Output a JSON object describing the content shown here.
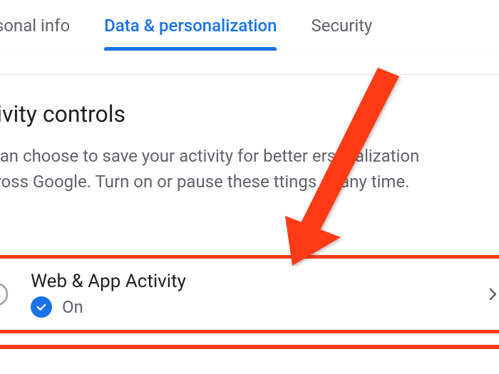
{
  "tabs": {
    "personal_info": "ersonal info",
    "data_personalization": "Data & personalization",
    "security": "Security"
  },
  "section": {
    "title": "ctivity controls",
    "description": "u can choose to save your activity for better ersonalization across Google. Turn on or pause these ttings at any time."
  },
  "activity": {
    "title": "Web & App Activity",
    "status": "On"
  },
  "colors": {
    "accent": "#1a73e8",
    "highlight": "#ff3b17",
    "text_primary": "#202124",
    "text_secondary": "#5f6368"
  }
}
